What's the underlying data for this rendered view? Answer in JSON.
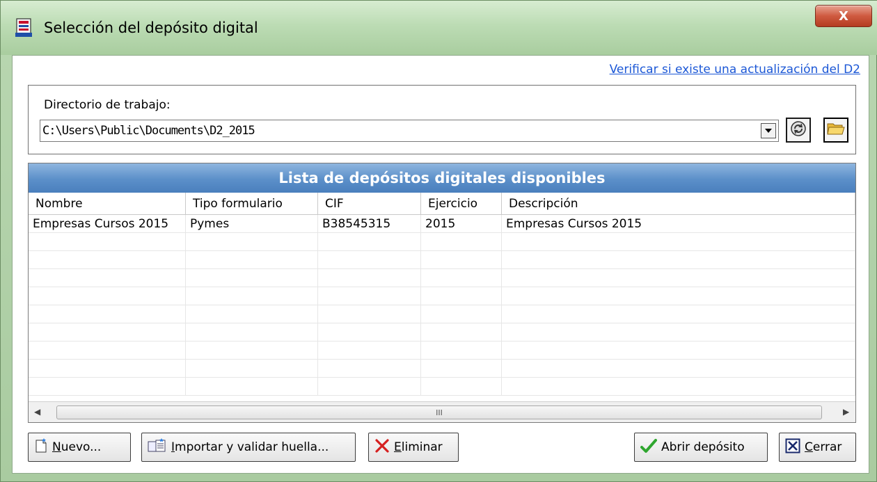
{
  "window": {
    "title": "Selección del depósito digital",
    "close_glyph": "X"
  },
  "links": {
    "update_check": "Verificar si existe una actualización del D2"
  },
  "workdir": {
    "label": "Directorio de trabajo:",
    "value": "C:\\Users\\Public\\Documents\\D2_2015"
  },
  "list": {
    "title": "Lista de depósitos digitales disponibles",
    "columns": [
      "Nombre",
      "Tipo formulario",
      "CIF",
      "Ejercicio",
      "Descripción"
    ],
    "rows": [
      [
        "Empresas Cursos 2015",
        "Pymes",
        "B38545315",
        "2015",
        "Empresas Cursos 2015"
      ]
    ],
    "scroll_thumb_grip": "III"
  },
  "buttons": {
    "nuevo": {
      "mnemonic": "N",
      "rest": "uevo..."
    },
    "importar": {
      "mnemonic": "I",
      "rest": "mportar y validar huella..."
    },
    "eliminar": {
      "mnemonic": "E",
      "rest": "liminar"
    },
    "abrir": {
      "label": "Abrir depósito"
    },
    "cerrar": {
      "mnemonic": "C",
      "rest": "errar"
    }
  },
  "icons": {
    "title": "app-document-icon",
    "refresh": "refresh-icon",
    "folder": "folder-open-icon",
    "nuevo": "new-document-icon",
    "importar": "import-icon",
    "eliminar": "delete-x-icon",
    "abrir": "checkmark-icon",
    "cerrar": "close-box-icon"
  },
  "colors": {
    "list_header": "#5b8fc9",
    "link": "#1b57d6",
    "close_button": "#cf5a40",
    "delete_x": "#d62020",
    "checkmark": "#2fa62f"
  }
}
